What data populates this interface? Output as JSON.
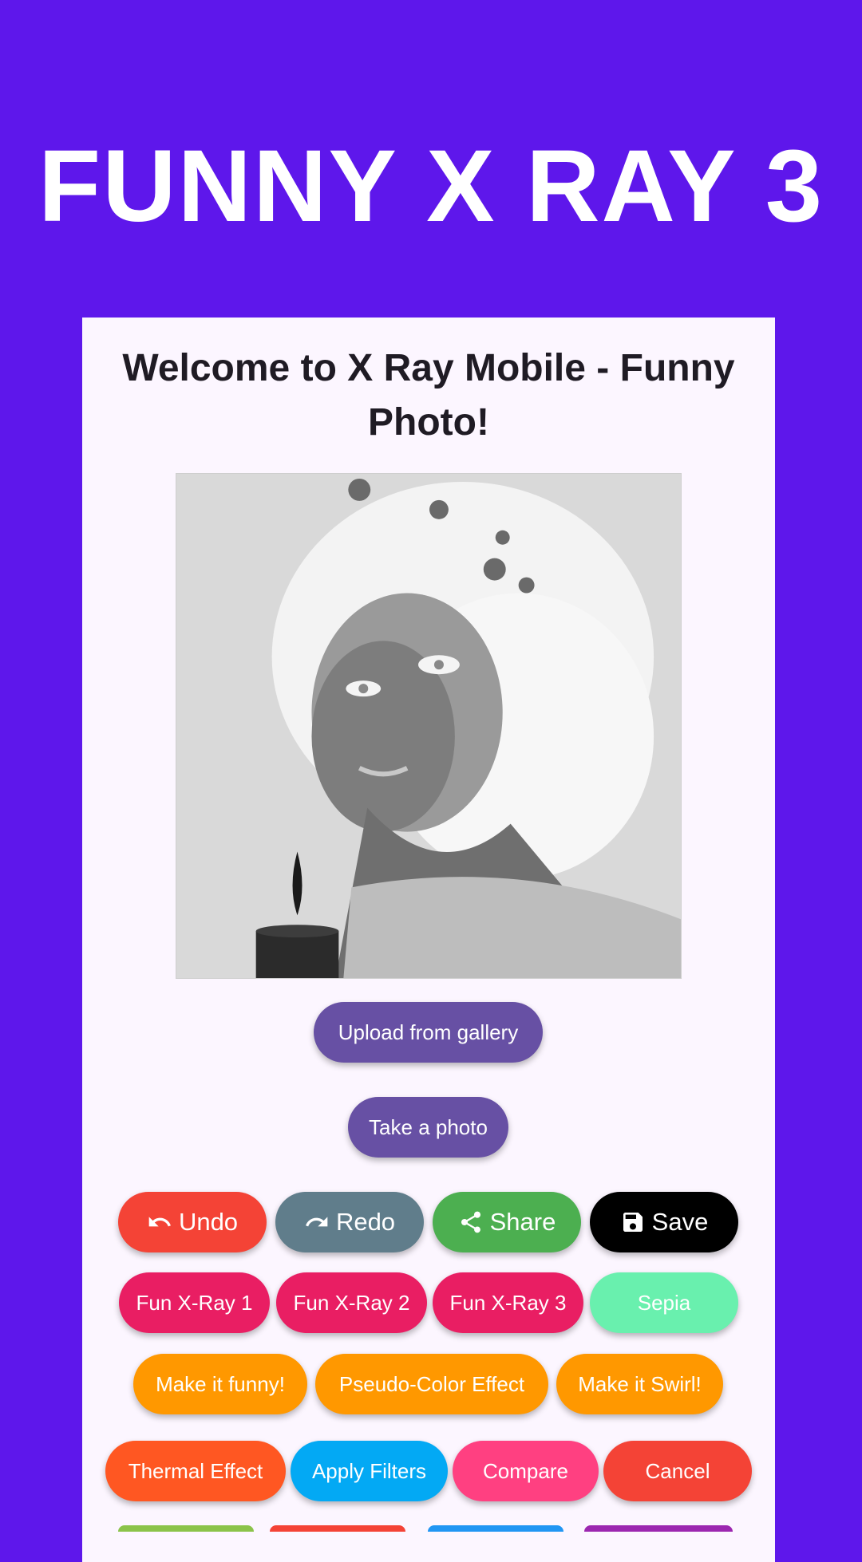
{
  "header": {
    "title": "FUNNY X RAY 3"
  },
  "card": {
    "welcome_text": "Welcome to X Ray Mobile - Funny Photo!",
    "photo_icon": "inverted-xray-portrait"
  },
  "buttons": {
    "upload": "Upload from gallery",
    "take_photo": "Take a photo",
    "undo": "Undo",
    "redo": "Redo",
    "share": "Share",
    "save": "Save",
    "fun_xray_1": "Fun X-Ray 1",
    "fun_xray_2": "Fun X-Ray 2",
    "fun_xray_3": "Fun X-Ray 3",
    "sepia": "Sepia",
    "make_funny": "Make it funny!",
    "pseudo_color": "Pseudo-Color Effect",
    "make_swirl": "Make it Swirl!",
    "thermal": "Thermal Effect",
    "apply_filters": "Apply Filters",
    "compare": "Compare",
    "cancel": "Cancel"
  },
  "colors": {
    "background": "#5e17eb",
    "card": "#fcf6ff",
    "primary_button": "#6750a4",
    "undo": "#f44336",
    "redo": "#607d8b",
    "share": "#4caf50",
    "save": "#000000",
    "fun_xray": "#e91e63",
    "sepia": "#69f0ae",
    "orange": "#ff9800",
    "thermal": "#ff5722",
    "apply": "#03a9f4",
    "compare": "#ff4081",
    "cancel": "#f44336"
  },
  "icons": {
    "undo": "undo-icon",
    "redo": "redo-icon",
    "share": "share-icon",
    "save": "save-icon"
  }
}
